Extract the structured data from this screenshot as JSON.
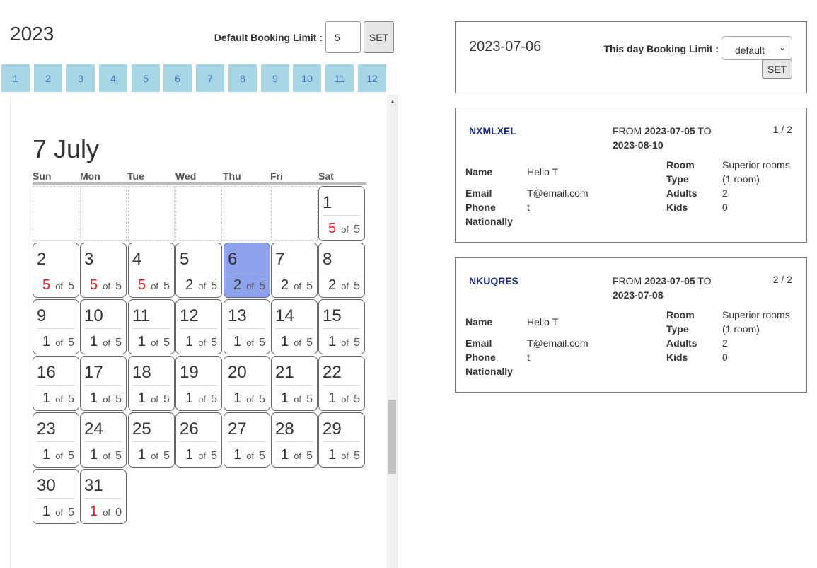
{
  "year": "2023",
  "default_limit": {
    "label": "Default Booking Limit :",
    "value": "5",
    "set_label": "SET"
  },
  "months": [
    "1",
    "2",
    "3",
    "4",
    "5",
    "6",
    "7",
    "8",
    "9",
    "10",
    "11",
    "12"
  ],
  "calendar": {
    "title": "7 July",
    "weekdays": [
      "Sun",
      "Mon",
      "Tue",
      "Wed",
      "Thu",
      "Fri",
      "Sat"
    ],
    "leading_blanks": 6,
    "of_label": "of",
    "selected_day": "6",
    "days": [
      {
        "day": "1",
        "booked": "5",
        "limit": "5",
        "full": true
      },
      {
        "day": "2",
        "booked": "5",
        "limit": "5",
        "full": true
      },
      {
        "day": "3",
        "booked": "5",
        "limit": "5",
        "full": true
      },
      {
        "day": "4",
        "booked": "5",
        "limit": "5",
        "full": true
      },
      {
        "day": "5",
        "booked": "2",
        "limit": "5",
        "full": false
      },
      {
        "day": "6",
        "booked": "2",
        "limit": "5",
        "full": false
      },
      {
        "day": "7",
        "booked": "2",
        "limit": "5",
        "full": false
      },
      {
        "day": "8",
        "booked": "2",
        "limit": "5",
        "full": false
      },
      {
        "day": "9",
        "booked": "1",
        "limit": "5",
        "full": false
      },
      {
        "day": "10",
        "booked": "1",
        "limit": "5",
        "full": false
      },
      {
        "day": "11",
        "booked": "1",
        "limit": "5",
        "full": false
      },
      {
        "day": "12",
        "booked": "1",
        "limit": "5",
        "full": false
      },
      {
        "day": "13",
        "booked": "1",
        "limit": "5",
        "full": false
      },
      {
        "day": "14",
        "booked": "1",
        "limit": "5",
        "full": false
      },
      {
        "day": "15",
        "booked": "1",
        "limit": "5",
        "full": false
      },
      {
        "day": "16",
        "booked": "1",
        "limit": "5",
        "full": false
      },
      {
        "day": "17",
        "booked": "1",
        "limit": "5",
        "full": false
      },
      {
        "day": "18",
        "booked": "1",
        "limit": "5",
        "full": false
      },
      {
        "day": "19",
        "booked": "1",
        "limit": "5",
        "full": false
      },
      {
        "day": "20",
        "booked": "1",
        "limit": "5",
        "full": false
      },
      {
        "day": "21",
        "booked": "1",
        "limit": "5",
        "full": false
      },
      {
        "day": "22",
        "booked": "1",
        "limit": "5",
        "full": false
      },
      {
        "day": "23",
        "booked": "1",
        "limit": "5",
        "full": false
      },
      {
        "day": "24",
        "booked": "1",
        "limit": "5",
        "full": false
      },
      {
        "day": "25",
        "booked": "1",
        "limit": "5",
        "full": false
      },
      {
        "day": "26",
        "booked": "1",
        "limit": "5",
        "full": false
      },
      {
        "day": "27",
        "booked": "1",
        "limit": "5",
        "full": false
      },
      {
        "day": "28",
        "booked": "1",
        "limit": "5",
        "full": false
      },
      {
        "day": "29",
        "booked": "1",
        "limit": "5",
        "full": false
      },
      {
        "day": "30",
        "booked": "1",
        "limit": "5",
        "full": false
      },
      {
        "day": "31",
        "booked": "1",
        "limit": "0",
        "full": true
      }
    ]
  },
  "day_limit": {
    "date": "2023-07-06",
    "label": "This day Booking Limit :",
    "selected": "default",
    "set_label": "SET"
  },
  "booking_labels": {
    "from": "FROM",
    "to": "TO",
    "name": "Name",
    "email": "Email",
    "phone": "Phone",
    "nationally": "Nationally",
    "room_type": "Room Type",
    "adults": "Adults",
    "kids": "Kids"
  },
  "bookings": [
    {
      "code": "NXMLXEL",
      "from_date": "2023-07-05",
      "to_date": "2023-08-10",
      "index": "1 / 2",
      "name": "Hello T",
      "email": "T@email.com",
      "phone": "t",
      "nationally": "",
      "room_type": "Superior rooms (1 room)",
      "adults": "2",
      "kids": "0"
    },
    {
      "code": "NKUQRES",
      "from_date": "2023-07-05",
      "to_date": "2023-07-08",
      "index": "2 / 2",
      "name": "Hello T",
      "email": "T@email.com",
      "phone": "t",
      "nationally": "",
      "room_type": "Superior rooms (1 room)",
      "adults": "2",
      "kids": "0"
    }
  ],
  "colors": {
    "month_tab_bg": "#a9d6e5",
    "month_tab_text": "#3a78c2",
    "selected_day_bg": "#8fa3ed",
    "full_count": "#e02020",
    "booking_code": "#1a2a8a"
  }
}
